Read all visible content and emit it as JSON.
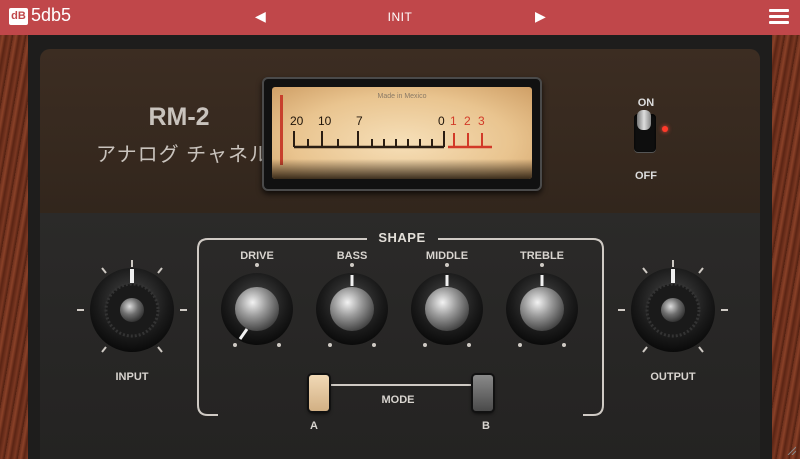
{
  "header": {
    "logo_badge": "dB",
    "brand": "5db5",
    "prev_arrow": "◀",
    "preset_name": "INIT",
    "next_arrow": "▶",
    "accent_color": "#c0474a"
  },
  "plugin": {
    "model": "RM-2",
    "subtitle": "アナログ チャネル"
  },
  "meter": {
    "made_in": "Made in Mexico",
    "scale_black": [
      "20",
      "10",
      "7",
      "0"
    ],
    "scale_red": [
      "1",
      "2",
      "3"
    ],
    "red_color": "#d23a28"
  },
  "power": {
    "on_label": "ON",
    "off_label": "OFF",
    "state": "on"
  },
  "controls": {
    "input_label": "INPUT",
    "output_label": "OUTPUT",
    "shape_label": "SHAPE",
    "drive_label": "DRIVE",
    "bass_label": "BASS",
    "middle_label": "MIDDLE",
    "treble_label": "TREBLE",
    "mode_label": "MODE",
    "mode_a": "A",
    "mode_b": "B",
    "mode_selected": "A"
  },
  "icons": {
    "menu": "hamburger-menu-icon",
    "prev": "triangle-left-icon",
    "next": "triangle-right-icon"
  }
}
